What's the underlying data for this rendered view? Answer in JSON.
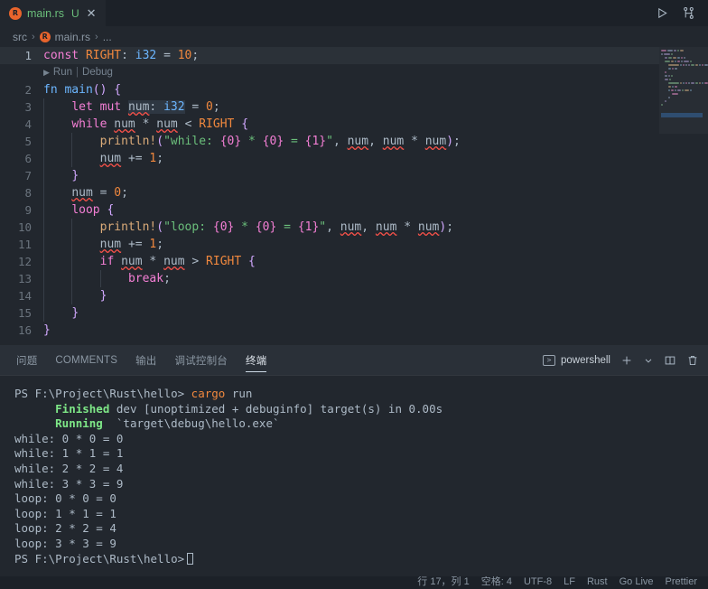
{
  "window": {
    "tab": {
      "icon": "rust-file-icon",
      "filename": "main.rs",
      "dirty_marker": "U",
      "close": "✕"
    },
    "actions": {
      "run": "run-icon",
      "split": "split-editor-icon"
    }
  },
  "breadcrumb": {
    "items": [
      "src",
      "main.rs",
      "..."
    ],
    "separator": "›"
  },
  "codelens": {
    "play": "▶",
    "run": "Run",
    "bar": "|",
    "debug": "Debug"
  },
  "editor": {
    "language": "rust",
    "current_line": 1,
    "lines": [
      {
        "n": "1",
        "code": "const RIGHT: i32 = 10;"
      },
      {
        "n": "2",
        "code": "fn main() {"
      },
      {
        "n": "3",
        "code": "    let mut num: i32 = 0;"
      },
      {
        "n": "4",
        "code": "    while num * num < RIGHT {"
      },
      {
        "n": "5",
        "code": "        println!(\"while: {0} * {0} = {1}\", num, num * num);"
      },
      {
        "n": "6",
        "code": "        num += 1;"
      },
      {
        "n": "7",
        "code": "    }"
      },
      {
        "n": "8",
        "code": "    num = 0;"
      },
      {
        "n": "9",
        "code": "    loop {"
      },
      {
        "n": "10",
        "code": "        println!(\"loop: {0} * {0} = {1}\", num, num * num);"
      },
      {
        "n": "11",
        "code": "        num += 1;"
      },
      {
        "n": "12",
        "code": "        if num * num > RIGHT {"
      },
      {
        "n": "13",
        "code": "            break;"
      },
      {
        "n": "14",
        "code": "        }"
      },
      {
        "n": "15",
        "code": "    }"
      },
      {
        "n": "16",
        "code": "}"
      }
    ]
  },
  "panel": {
    "tabs": [
      {
        "label": "问题",
        "active": false
      },
      {
        "label": "COMMENTS",
        "active": false
      },
      {
        "label": "输出",
        "active": false
      },
      {
        "label": "调试控制台",
        "active": false
      },
      {
        "label": "终端",
        "active": true
      }
    ],
    "terminal_name": "powershell",
    "actions": {
      "new": "+",
      "dropdown": "⌄",
      "split": "split-terminal-icon",
      "kill": "trash-icon"
    }
  },
  "terminal": {
    "prompt": "PS F:\\Project\\Rust\\hello>",
    "command": "cargo",
    "command_args": " run",
    "lines": [
      {
        "type": "status",
        "label": "Finished",
        "text": " dev [unoptimized + debuginfo] target(s) in 0.00s"
      },
      {
        "type": "status",
        "label": "Running",
        "text": "  `target\\debug\\hello.exe`"
      },
      {
        "type": "out",
        "text": "while: 0 * 0 = 0"
      },
      {
        "type": "out",
        "text": "while: 1 * 1 = 1"
      },
      {
        "type": "out",
        "text": "while: 2 * 2 = 4"
      },
      {
        "type": "out",
        "text": "while: 3 * 3 = 9"
      },
      {
        "type": "out",
        "text": "loop: 0 * 0 = 0"
      },
      {
        "type": "out",
        "text": "loop: 1 * 1 = 1"
      },
      {
        "type": "out",
        "text": "loop: 2 * 2 = 4"
      },
      {
        "type": "out",
        "text": "loop: 3 * 3 = 9"
      }
    ],
    "final_prompt": "PS F:\\Project\\Rust\\hello>"
  },
  "statusbar": {
    "right": [
      "行 17，列 1",
      "空格: 4",
      "UTF-8",
      "LF",
      "Rust",
      "Go Live",
      "Prettier"
    ]
  },
  "colors": {
    "editor_bg": "#22272e",
    "tabbar_bg": "#1c2128",
    "panel_tabbar_bg": "#2a3038",
    "accent_green": "#6bbf7b",
    "rust_orange": "#e8642c",
    "error_red": "#f85149",
    "status_green": "#7ee787"
  }
}
